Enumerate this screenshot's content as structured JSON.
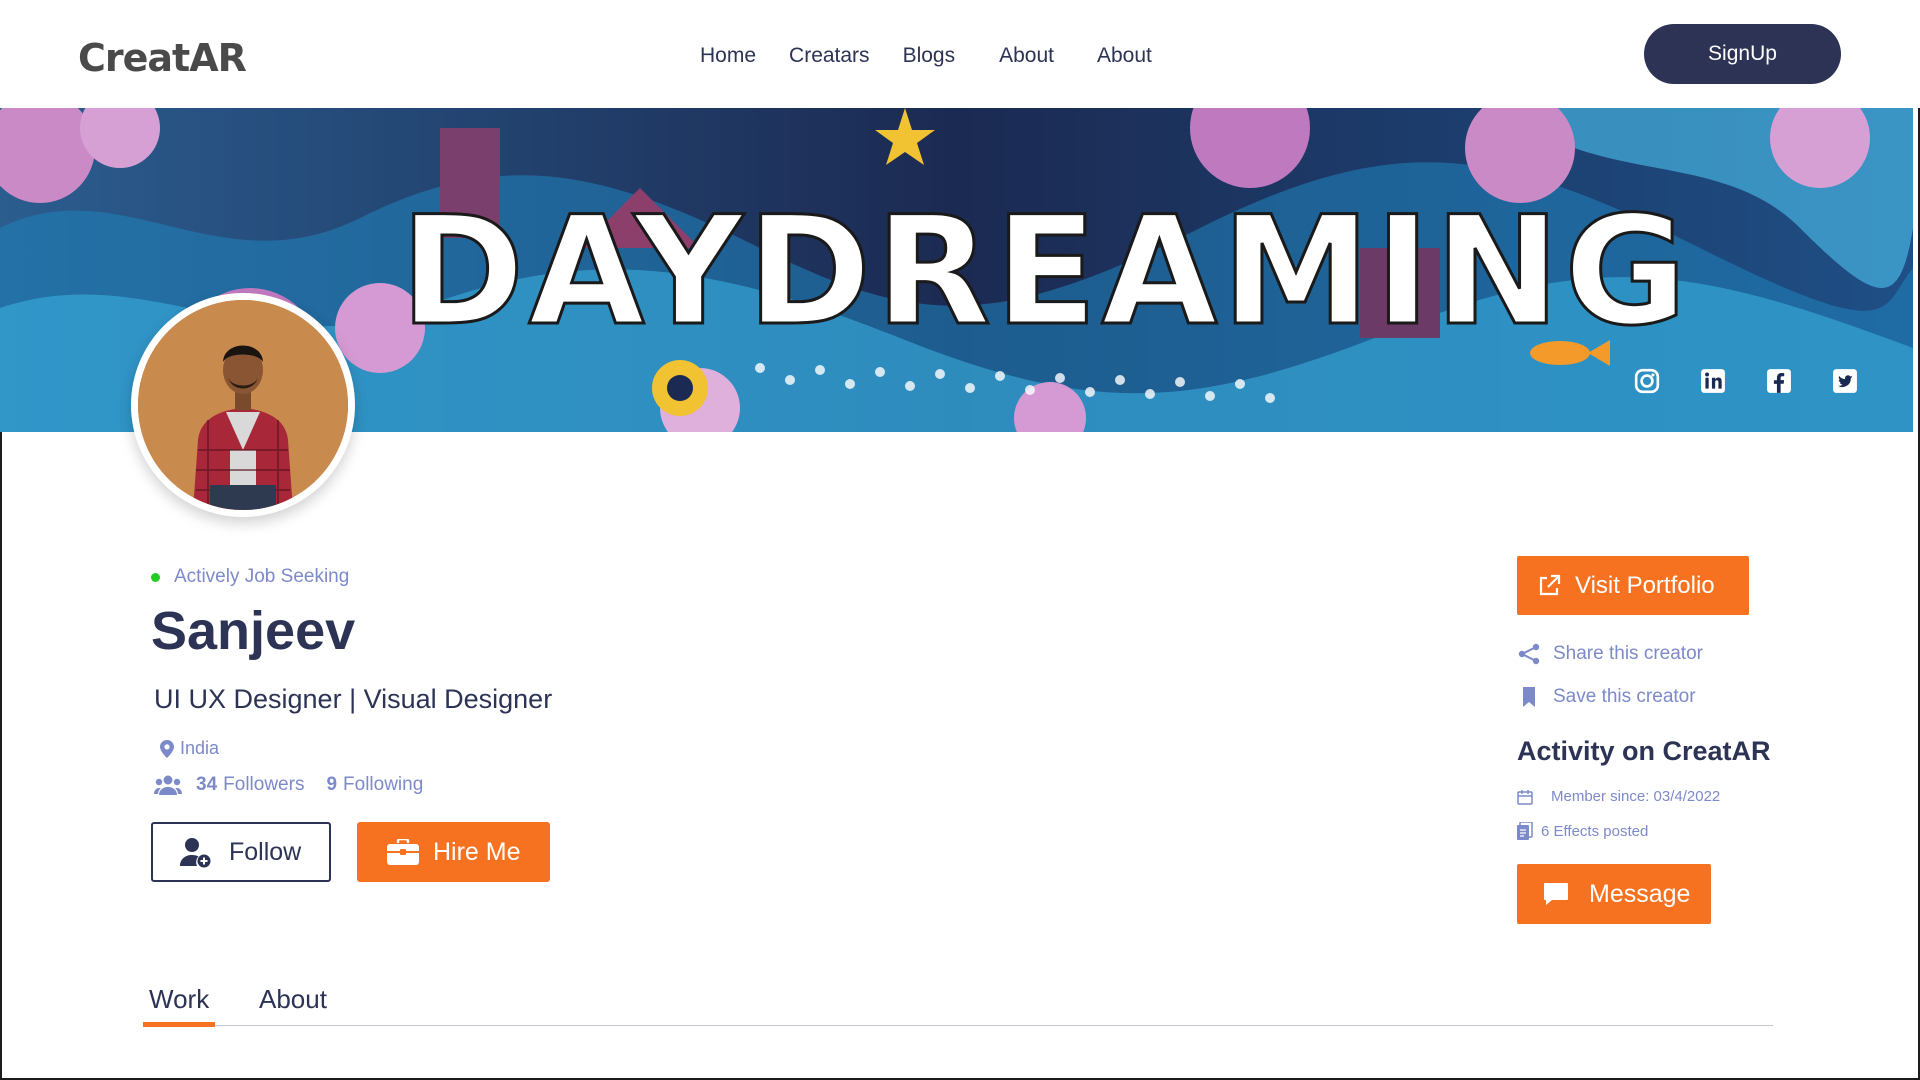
{
  "header": {
    "logo": "CreatAR",
    "nav": [
      "Home",
      "Creatars",
      "Blogs",
      "About",
      "About"
    ],
    "signup_label": "SignUp"
  },
  "banner": {
    "text": "DAYDREAMING",
    "social_icons": [
      "instagram-icon",
      "linkedin-icon",
      "facebook-icon",
      "twitter-icon"
    ]
  },
  "profile": {
    "status": "Actively Job Seeking",
    "name": "Sanjeev",
    "title": "UI UX Designer | Visual Designer",
    "location": "India",
    "followers_count": "34",
    "followers_label": "Followers",
    "following_count": "9",
    "following_label": "Following",
    "follow_label": "Follow",
    "hire_label": "Hire Me"
  },
  "sidebar": {
    "portfolio_label": "Visit Portfolio",
    "share_label": "Share this creator",
    "save_label": "Save this creator",
    "activity_title": "Activity on CreatAR",
    "member_since": "Member since: 03/4/2022",
    "effects_posted": "6 Effects posted",
    "message_label": "Message"
  },
  "tabs": [
    "Work",
    "About"
  ],
  "colors": {
    "accent": "#f77220",
    "navy": "#2d3354",
    "muted": "#7d8ac9",
    "online": "#22cc22"
  }
}
